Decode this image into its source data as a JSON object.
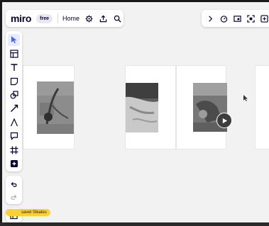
{
  "app": {
    "logo_text": "miro",
    "plan_badge": "free",
    "home_label": "Home"
  },
  "top_toolbar": {
    "icons": [
      "settings-icon",
      "share-upload-icon",
      "search-icon"
    ]
  },
  "top_right_toolbar": {
    "icons": [
      "chevron-right-icon",
      "timer-icon",
      "present-icon",
      "focus-icon",
      "more-icon"
    ]
  },
  "tool_rail": {
    "tools": [
      "select",
      "templates",
      "text",
      "sticky-note",
      "shapes",
      "connection-line",
      "pen",
      "comment",
      "frame",
      "add-more"
    ],
    "active": "select"
  },
  "history": {
    "undo": "undo-icon",
    "redo": "redo-icon"
  },
  "collaborator": {
    "name": "savet Sikalou",
    "color": "#ffd02f"
  },
  "colors": {
    "canvas_bg": "#f2f2f2",
    "panel_bg": "#ffffff",
    "accent": "#4262ff",
    "text": "#050038"
  }
}
